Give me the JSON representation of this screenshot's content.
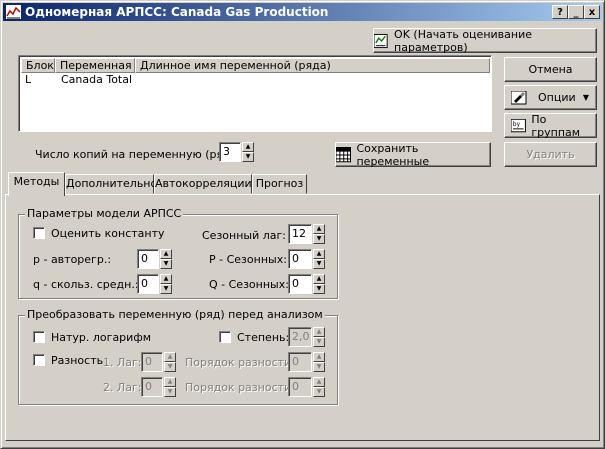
{
  "window": {
    "title": "Одномерная АРПСС: Canada Gas Production",
    "title_buttons": [
      "?",
      "_",
      "x"
    ]
  },
  "buttons": {
    "ok": "OK (Начать оценивание параметров)",
    "cancel": "Отмена",
    "options": "Опции",
    "by_groups": "По группам",
    "save_vars": "Сохранить переменные",
    "delete": "Удалить"
  },
  "varlist": {
    "columns": [
      "Блок",
      "Переменная",
      "Длинное имя переменной (ряда)"
    ],
    "rows": [
      {
        "block": "L",
        "variable": "Canada Total",
        "long_name": ""
      }
    ]
  },
  "copies": {
    "label": "Число копий на переменную (ряд):",
    "value": "3"
  },
  "tabs": [
    "Методы",
    "Дополнительно",
    "Автокорреляции",
    "Прогноз"
  ],
  "arima_params": {
    "title": "Параметры модели АРПСС",
    "estimate_constant": "Оценить константу",
    "p_label": "p - авторегр.:",
    "p_value": "0",
    "q_label": "q - скольз. средн.:",
    "q_value": "0",
    "seasonal_lag_label": "Сезонный лаг:",
    "seasonal_lag_value": "12",
    "P_label": "P - Сезонных:",
    "P_value": "0",
    "Q_label": "Q - Сезонных:",
    "Q_value": "0"
  },
  "transform": {
    "title": "Преобразовать переменную (ряд) перед анализом",
    "natural_log": "Натур. логарифм",
    "power_label": "Степень:",
    "power_value": "2,0",
    "difference": "Разность",
    "lag1_label": "1. Лаг:",
    "lag1_value": "0",
    "order1_label": "Порядок разности:",
    "order1_value": "0",
    "lag2_label": "2. Лаг:",
    "lag2_value": "0",
    "order2_label": "Порядок разности:",
    "order2_value": "0"
  }
}
